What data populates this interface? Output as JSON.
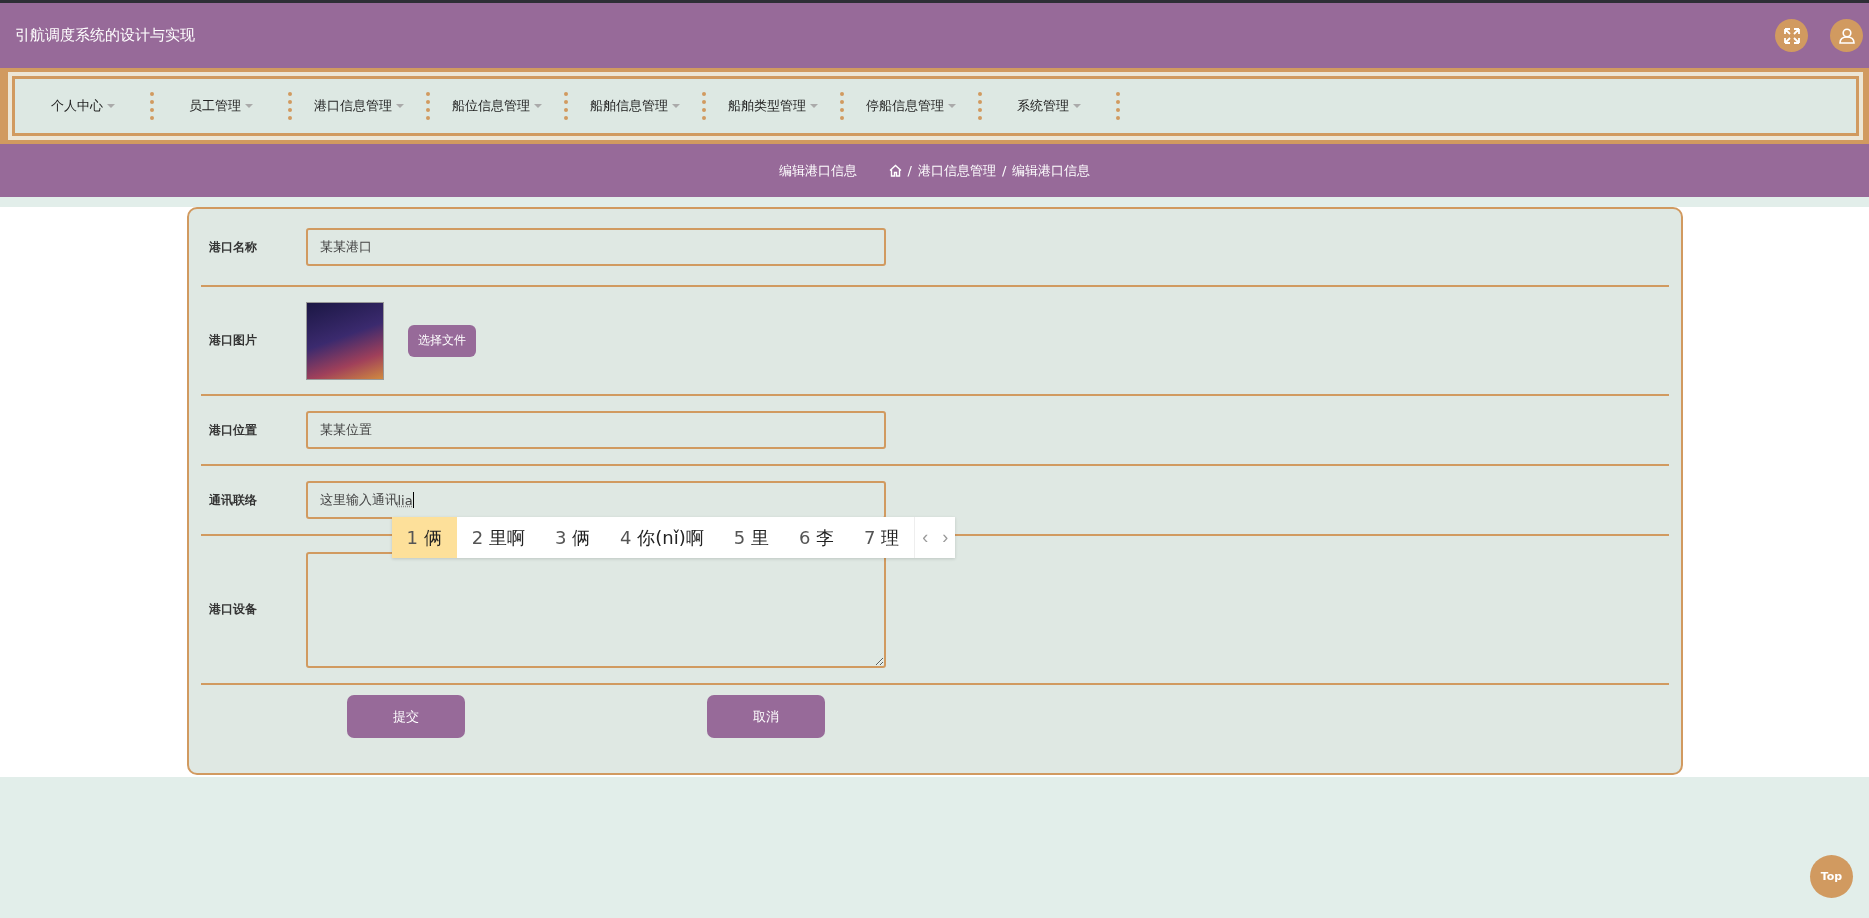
{
  "header": {
    "title": "引航调度系统的设计与实现"
  },
  "menu": [
    {
      "label": "个人中心"
    },
    {
      "label": "员工管理"
    },
    {
      "label": "港口信息管理"
    },
    {
      "label": "船位信息管理"
    },
    {
      "label": "船舶信息管理"
    },
    {
      "label": "船舶类型管理"
    },
    {
      "label": "停船信息管理"
    },
    {
      "label": "系统管理"
    }
  ],
  "breadcrumb": {
    "page_title": "编辑港口信息",
    "trail": [
      {
        "separator": "/",
        "label": "港口信息管理"
      },
      {
        "separator": "/",
        "label": "编辑港口信息"
      }
    ]
  },
  "form": {
    "fields": [
      {
        "kind": "text",
        "label": "港口名称",
        "value": "某某港口"
      },
      {
        "kind": "image",
        "label": "港口图片",
        "button": "选择文件"
      },
      {
        "kind": "text",
        "label": "港口位置",
        "value": "某某位置"
      },
      {
        "kind": "composing",
        "label": "通讯联络",
        "value": "这里输入通讯",
        "composition": "lia"
      },
      {
        "kind": "textarea",
        "label": "港口设备"
      }
    ],
    "buttons": [
      "提交",
      "取消"
    ]
  },
  "ime": {
    "candidates": [
      {
        "number": "1",
        "text": "俩",
        "selected": true
      },
      {
        "number": "2",
        "text": "里啊",
        "selected": false
      },
      {
        "number": "3",
        "text": "俩",
        "selected": false
      },
      {
        "number": "4",
        "text": "你(nǐ)啊",
        "selected": false
      },
      {
        "number": "5",
        "text": "里",
        "selected": false
      },
      {
        "number": "6",
        "text": "李",
        "selected": false
      },
      {
        "number": "7",
        "text": "理",
        "selected": false
      }
    ],
    "prev": "‹",
    "next": "›"
  },
  "back_to_top": "Top"
}
